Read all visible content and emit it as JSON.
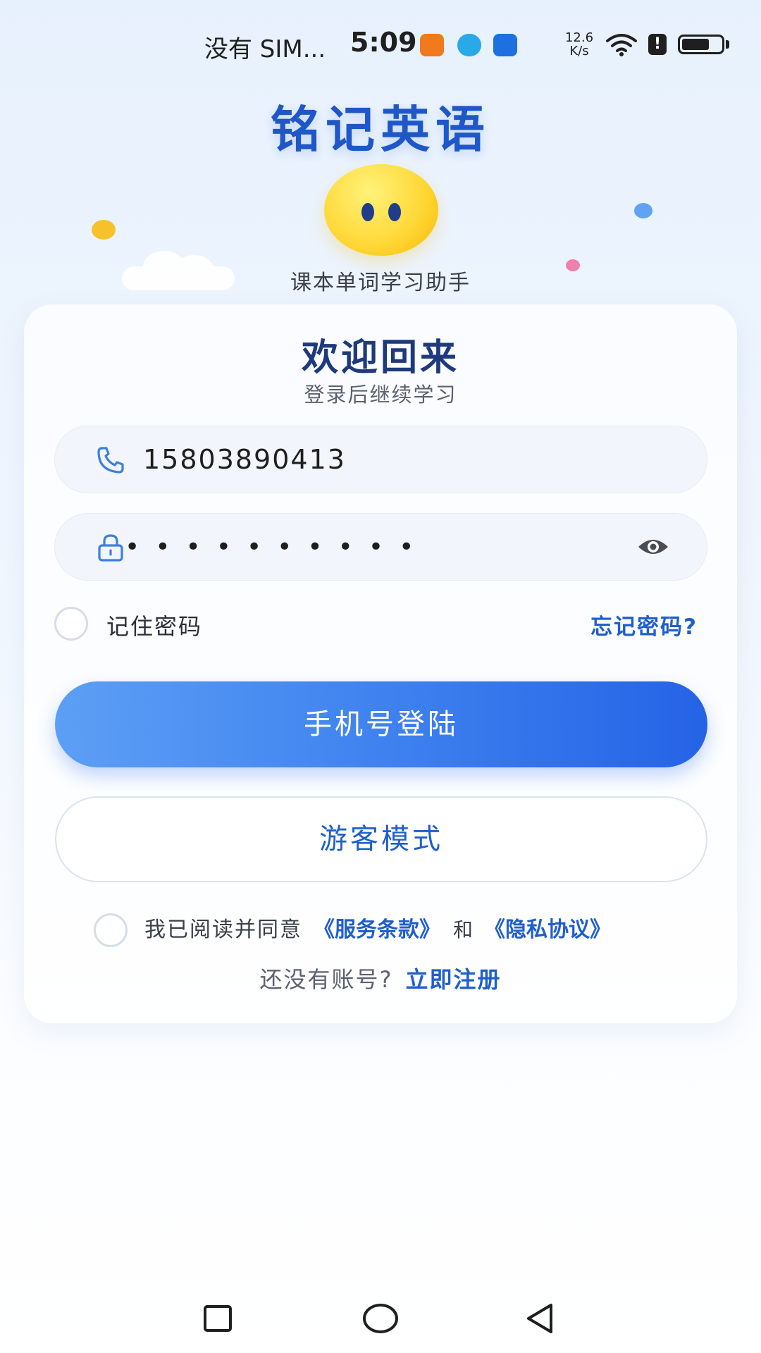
{
  "status_bar": {
    "carrier": "没有 SIM...",
    "time": "5:09",
    "net_speed_value": "12.6",
    "net_speed_unit": "K/s",
    "battery_level": 0.7,
    "icons": [
      "app-notification-icon",
      "browser-icon",
      "assistant-icon",
      "wifi-icon",
      "alert-icon",
      "battery-icon"
    ]
  },
  "brand": {
    "title": "铭记英语",
    "subtitle": "课本单词学习助手"
  },
  "card": {
    "welcome_title": "欢迎回来",
    "welcome_subtitle": "登录后继续学习"
  },
  "form": {
    "phone_value": "15803890413",
    "password_mask": "••••••••••"
  },
  "options": {
    "remember_label": "记住密码",
    "forgot_label": "忘记密码?"
  },
  "buttons": {
    "login_label": "手机号登陆",
    "guest_label": "游客模式"
  },
  "agreement": {
    "prefix": "我已阅读并同意",
    "terms_label": "《服务条款》",
    "and_label": "和",
    "privacy_label": "《隐私协议》"
  },
  "register": {
    "prompt": "还没有账号?",
    "link_label": "立即注册"
  },
  "nav_bar": {
    "buttons": [
      "recents-square-icon",
      "home-circle-icon",
      "back-triangle-icon"
    ]
  },
  "colors": {
    "accent": "#1f5fcc",
    "title": "#1f57c8",
    "primary_button_start": "#5c9ff5",
    "primary_button_end": "#2563e6",
    "mascot": "#ffd93a"
  }
}
